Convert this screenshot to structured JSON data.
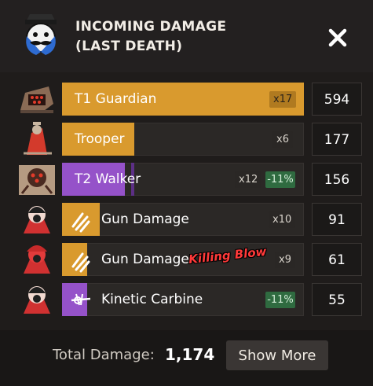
{
  "header": {
    "title_line1": "INCOMING DAMAGE",
    "title_line2": "(LAST DEATH)",
    "close_icon": "close-icon",
    "avatar_icon": "mustache-portrait-icon"
  },
  "rows": [
    {
      "label": "T1 Guardian",
      "multiplier": "x17",
      "resist": "",
      "value": "594",
      "fill_fraction": 1.0,
      "bar_color": "#d99a2e",
      "icon": "guardian-enemy-icon"
    },
    {
      "label": "Trooper",
      "multiplier": "x6",
      "resist": "",
      "value": "177",
      "fill_fraction": 0.3,
      "bar_color": "#d99a2e",
      "icon": "trooper-enemy-icon"
    },
    {
      "label": "T2 Walker",
      "multiplier": "x12",
      "resist": "-11%",
      "value": "156",
      "fill_fraction": 0.26,
      "bar_color": "#9552c9",
      "icon": "walker-enemy-icon"
    },
    {
      "label": "Gun Damage",
      "multiplier": "x10",
      "resist": "",
      "value": "91",
      "fill_fraction": 0.15,
      "bar_color": "#d99a2e",
      "icon": "hero-portrait-icon",
      "weapon_icon": "bullet-icon"
    },
    {
      "label": "Gun Damage",
      "multiplier": "x9",
      "resist": "",
      "value": "61",
      "fill_fraction": 0.1,
      "bar_color": "#d99a2e",
      "icon": "hero-portrait-icon",
      "weapon_icon": "bullet-icon",
      "tag": "Killing Blow"
    },
    {
      "label": "Kinetic Carbine",
      "multiplier": "",
      "resist": "-11%",
      "value": "55",
      "fill_fraction": 0.1,
      "bar_color": "#9552c9",
      "icon": "hero-portrait-icon",
      "weapon_icon": "kinetic-carbine-icon"
    }
  ],
  "footer": {
    "total_label": "Total Damage:",
    "total_value": "1,174",
    "show_more_label": "Show More"
  }
}
